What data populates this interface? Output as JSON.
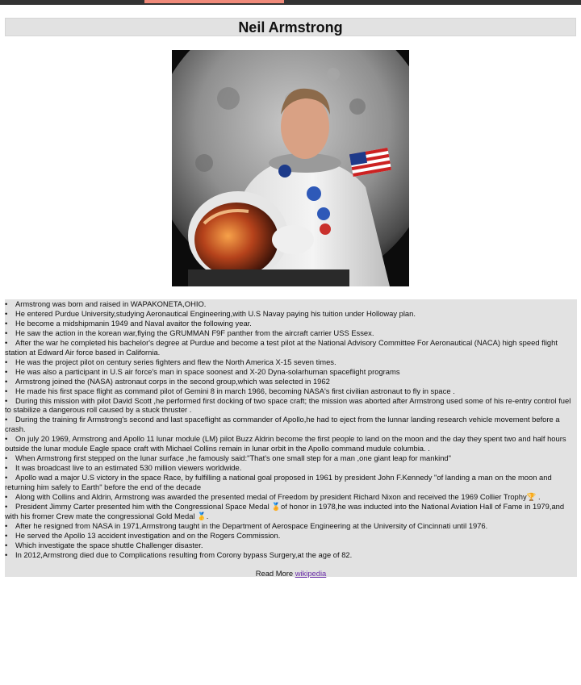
{
  "page": {
    "title": "Neil Armstrong",
    "photo_alt": "Neil Armstrong in astronaut suit",
    "colors": {
      "topbar": "#333333",
      "topbar_highlight": "#f08a7a",
      "panel": "#e2e2e2",
      "link": "#6a2da8"
    }
  },
  "facts": [
    "Armstrong was born and raised in WAPAKONETA,OHIO.",
    "He entered Purdue University,studying Aeronautical Engineering,with U.S Navay paying his tuition under Holloway plan.",
    "He become a midshipmanin 1949 and Naval avaitor the following year.",
    "He saw the action in the korean war,flying the GRUMMAN F9F panther from the aircraft carrier USS Essex.",
    "After the war he completed his bachelor's degree at Purdue and become a test pilot at the National Advisory Committee For Aeronautical (NACA) high speed flight station at Edward Air force based in California.",
    "He was the project pilot on century series fighters and flew the North America X-15 seven times.",
    "He was also a participant in U.S air force's man in space soonest and X-20 Dyna-solarhuman spaceflight programs",
    "Armstrong joined the (NASA) astronaut corps in the second group,which was selected in 1962",
    "He made his first space flight as command pilot of Gemini 8 in march 1966, becoming NASA's first civilian astronaut to fly in space .",
    "During this mission with pilot David Scott ,he performed first docking of two space craft; the mission was aborted after Armstrong used some of his re-entry control fuel to stabilize a dangerous roll caused by a stuck thruster .",
    "During the training fir Armstrong's second and last spaceflight as commander of Apollo,he had to eject from the lunnar landing research vehicle movement before a crash.",
    "On july 20 1969, Armstrong and Apollo 11 lunar module (LM) pilot Buzz Aldrin become the first people to land on the moon and the day they spent two and half hours outside the lunar module Eagle space craft with Michael Collins remain in lunar orbit in the Apollo command mudule columbia. .",
    "When Armstrong first stepped on the lunar surface ,he famously said:\"That's one small step for a man ,one giant leap for mankind\"",
    "It was broadcast live to an estimated 530 million viewers worldwide.",
    "Apollo wad a major U.S victory in the space Race, by fulfilling a national goal proposed in 1961 by president John F.Kennedy \"of landing a man on the moon and returning him safely to Earth\" before the end of the decade",
    "Along with Collins and Aldrin, Armstrong was awarded the presented medal of Freedom by president Richard Nixon and received the 1969 Collier Trophy🏆 .",
    "President Jimmy Carter presented him with the Congressional Space Medal 🏅of honor in 1978,he was inducted into the National Aviation Hall of Fame in 1979,and with his fromer Crew mate the congressional Gold Medal 🥇.",
    "After he resigned from NASA in 1971,Armstrong taught in the Department of Aerospace Engineering at the University of Cincinnati until 1976.",
    "He served the Apollo 13 accident investigation and on the Rogers Commission.",
    "Which investigate the space shuttle Challenger disaster.",
    "In 2012,Armstrong died due to Complications resulting from Corony bypass Surgery,at the age of 82."
  ],
  "read_more": {
    "prefix": "Read More ",
    "link_text": "wikipedia"
  }
}
